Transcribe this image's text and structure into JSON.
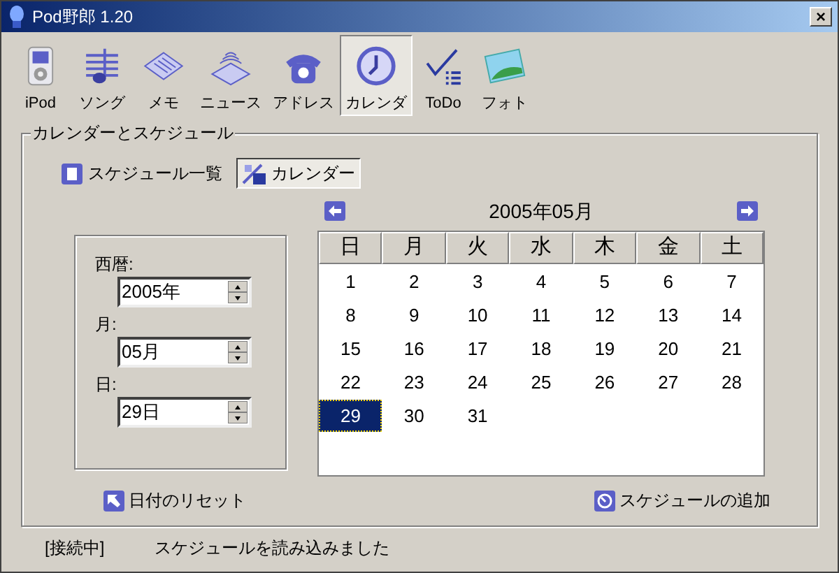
{
  "window": {
    "title": "Pod野郎 1.20",
    "close": "×"
  },
  "toolbar": [
    {
      "label": "iPod",
      "kind": "ipod",
      "selected": false
    },
    {
      "label": "ソング",
      "kind": "song",
      "selected": false
    },
    {
      "label": "メモ",
      "kind": "memo",
      "selected": false
    },
    {
      "label": "ニュース",
      "kind": "news",
      "selected": false
    },
    {
      "label": "アドレス",
      "kind": "address",
      "selected": false
    },
    {
      "label": "カレンダ",
      "kind": "calendar",
      "selected": true
    },
    {
      "label": "ToDo",
      "kind": "todo",
      "selected": false
    },
    {
      "label": "フォト",
      "kind": "photo",
      "selected": false
    }
  ],
  "group_title": "カレンダーとスケジュール",
  "tabs": [
    {
      "label": "スケジュール一覧",
      "kind": "list",
      "selected": false
    },
    {
      "label": "カレンダー",
      "kind": "calendar",
      "selected": true
    }
  ],
  "date_fields": [
    {
      "label": "西暦:",
      "value": "2005年"
    },
    {
      "label": "月:",
      "value": "05月"
    },
    {
      "label": "日:",
      "value": "29日"
    }
  ],
  "calendar": {
    "title": "2005年05月",
    "weekdays": [
      "日",
      "月",
      "火",
      "水",
      "木",
      "金",
      "土"
    ],
    "weeks": [
      [
        {
          "day": "1",
          "selected": false
        },
        {
          "day": "2",
          "selected": false
        },
        {
          "day": "3",
          "selected": false
        },
        {
          "day": "4",
          "selected": false
        },
        {
          "day": "5",
          "selected": false
        },
        {
          "day": "6",
          "selected": false
        },
        {
          "day": "7",
          "selected": false
        }
      ],
      [
        {
          "day": "8",
          "selected": false
        },
        {
          "day": "9",
          "selected": false
        },
        {
          "day": "10",
          "selected": false
        },
        {
          "day": "11",
          "selected": false
        },
        {
          "day": "12",
          "selected": false
        },
        {
          "day": "13",
          "selected": false
        },
        {
          "day": "14",
          "selected": false
        }
      ],
      [
        {
          "day": "15",
          "selected": false
        },
        {
          "day": "16",
          "selected": false
        },
        {
          "day": "17",
          "selected": false
        },
        {
          "day": "18",
          "selected": false
        },
        {
          "day": "19",
          "selected": false
        },
        {
          "day": "20",
          "selected": false
        },
        {
          "day": "21",
          "selected": false
        }
      ],
      [
        {
          "day": "22",
          "selected": false
        },
        {
          "day": "23",
          "selected": false
        },
        {
          "day": "24",
          "selected": false
        },
        {
          "day": "25",
          "selected": false
        },
        {
          "day": "26",
          "selected": false
        },
        {
          "day": "27",
          "selected": false
        },
        {
          "day": "28",
          "selected": false
        }
      ],
      [
        {
          "day": "29",
          "selected": true
        },
        {
          "day": "30",
          "selected": false
        },
        {
          "day": "31",
          "selected": false
        }
      ]
    ]
  },
  "reset_button": "日付のリセット",
  "add_button": "スケジュールの追加",
  "status_bar": {
    "connection": "[接続中]",
    "message": "スケジュールを読み込みました"
  }
}
